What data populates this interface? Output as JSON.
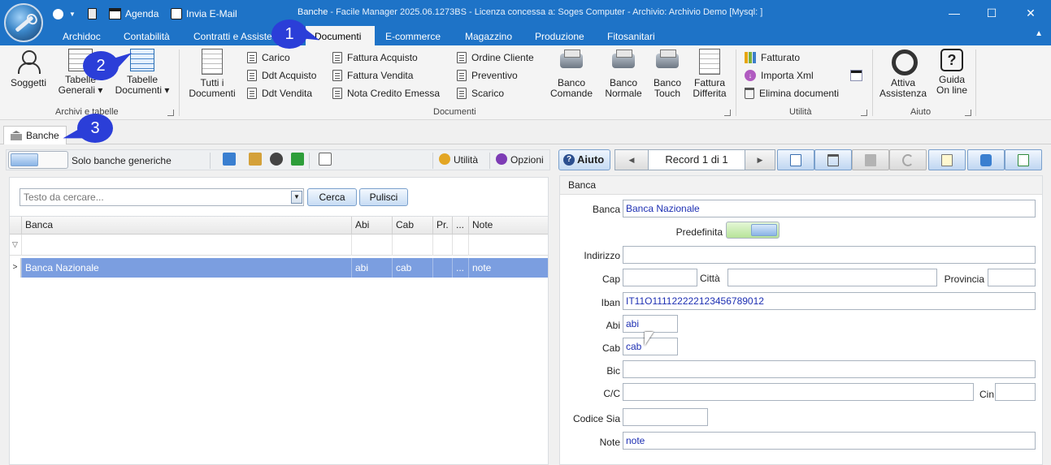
{
  "titlebar": {
    "agenda": "Agenda",
    "email": "Invia E-Mail",
    "window_title": "Banche",
    "window_subtitle": " - Facile Manager 2025.06.1273BS - Licenza concessa a: Soges Computer - Archivio: Archivio Demo  [Mysql: ]",
    "minimize": "—",
    "maximize": "☐",
    "close": "✕"
  },
  "ribbon_tabs": [
    "Archidoc",
    "Contabilità",
    "Contratti e Assistenza",
    "Documenti",
    "E-commerce",
    "Magazzino",
    "Produzione",
    "Fitosanitari"
  ],
  "ribbon_active_tab": "Documenti",
  "ribbon": {
    "archivi": {
      "group": "Archivi e tabelle",
      "soggetti": "Soggetti",
      "tabelle_generali": "Tabelle\nGenerali ▾",
      "tabelle_documenti": "Tabelle\nDocumenti ▾"
    },
    "documenti": {
      "group": "Documenti",
      "tutti": "Tutti i\nDocumenti",
      "col1": [
        "Carico",
        "Ddt Acquisto",
        "Ddt Vendita"
      ],
      "col2": [
        "Fattura Acquisto",
        "Fattura Vendita",
        "Nota Credito Emessa"
      ],
      "col3": [
        "Ordine Cliente",
        "Preventivo",
        "Scarico"
      ],
      "banco_comande": "Banco\nComande",
      "banco_normale": "Banco\nNormale",
      "banco_touch": "Banco\nTouch",
      "fattura_differita": "Fattura\nDifferita"
    },
    "utilita": {
      "group": "Utilità",
      "fatturato": "Fatturato",
      "importa_xml": "Importa Xml",
      "elimina_documenti": "Elimina documenti"
    },
    "aiuto": {
      "group": "Aiuto",
      "attiva_assistenza": "Attiva\nAssistenza",
      "guida_online": "Guida\nOn line"
    }
  },
  "callouts": [
    "1",
    "2",
    "3"
  ],
  "doc_tab": "Banche",
  "left": {
    "solo_generiche": "Solo banche generiche",
    "utilita": "Utilità",
    "opzioni": "Opzioni",
    "search_placeholder": "Testo da cercare...",
    "cerca": "Cerca",
    "pulisci": "Pulisci",
    "columns": [
      "Banca",
      "Abi",
      "Cab",
      "Pr.",
      "...",
      "Note"
    ],
    "rows": [
      {
        "banca": "Banca Nazionale",
        "abi": "abi",
        "cab": "cab",
        "pr": "",
        "dots": "...",
        "note": "note"
      }
    ]
  },
  "right": {
    "aiuto": "Aiuto",
    "record": "Record 1 di 1",
    "section": "Banca",
    "labels": {
      "banca": "Banca",
      "predefinita": "Predefinita",
      "indirizzo": "Indirizzo",
      "cap": "Cap",
      "citta": "Città",
      "provincia": "Provincia",
      "iban": "Iban",
      "abi": "Abi",
      "cab": "Cab",
      "bic": "Bic",
      "cc": "C/C",
      "cin": "Cin",
      "codice_sia": "Codice Sia",
      "note": "Note"
    },
    "values": {
      "banca": "Banca Nazionale",
      "indirizzo": "",
      "cap": "",
      "citta": "",
      "provincia": "",
      "iban": "IT11O111122222123456789012",
      "abi": "abi",
      "cab": "cab",
      "bic": "",
      "cc": "",
      "cin": "",
      "codice_sia": "",
      "note": "note"
    }
  },
  "colors": {
    "titlebar": "#1e73c7",
    "selected_row": "#7b9ee0",
    "callout": "#2b3ed8",
    "field_text": "#1d2fb3"
  }
}
